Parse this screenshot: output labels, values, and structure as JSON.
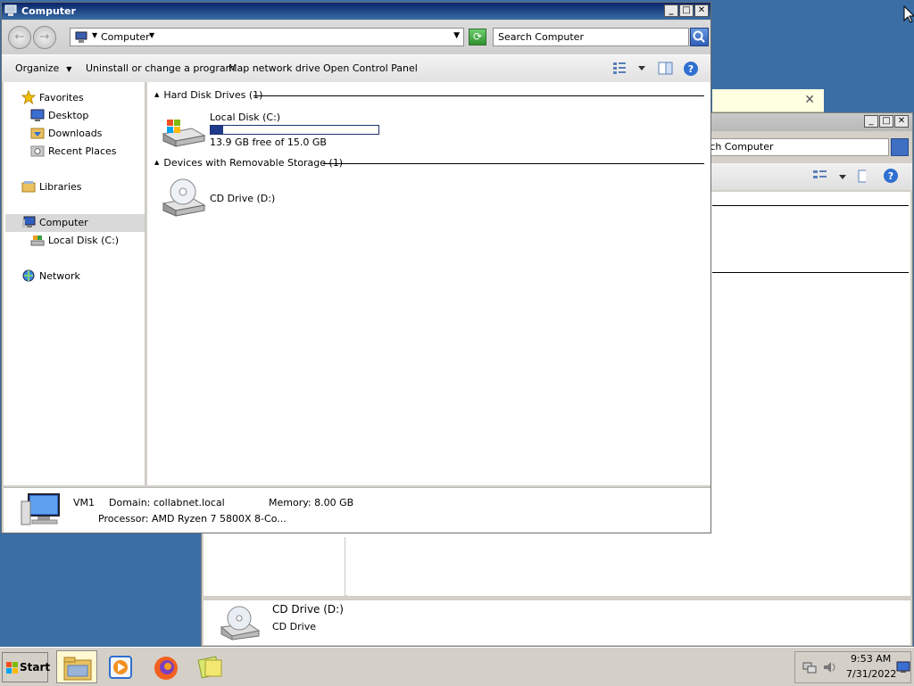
{
  "main_window": {
    "title": "Computer",
    "address": {
      "crumb": "Computer"
    },
    "search": {
      "placeholder": "Search Computer"
    },
    "toolbar": {
      "organize": "Organize",
      "uninstall": "Uninstall or change a program",
      "map_drive": "Map network drive",
      "control_panel": "Open Control Panel"
    },
    "nav": {
      "favorites": "Favorites",
      "desktop": "Desktop",
      "downloads": "Downloads",
      "recent_places": "Recent Places",
      "libraries": "Libraries",
      "computer": "Computer",
      "local_disk": "Local Disk (C:)",
      "network": "Network"
    },
    "content": {
      "hdd_group": "Hard Disk Drives (1)",
      "local_disk_name": "Local Disk (C:)",
      "local_disk_free": "13.9 GB free of 15.0 GB",
      "local_disk_used_fraction": 0.073,
      "removable_group": "Devices with Removable Storage (1)",
      "cd_drive_name": "CD Drive (D:)"
    },
    "details": {
      "computer_name": "VM1",
      "domain": "Domain: collabnet.local",
      "memory": "Memory: 8.00 GB",
      "processor": "Processor: AMD Ryzen 7 5800X 8-Co..."
    }
  },
  "background_window": {
    "search_partial": "rch Computer",
    "cd_drive_title": "CD Drive (D:)",
    "cd_drive_type": "CD Drive"
  },
  "taskbar": {
    "start": "Start",
    "time": "9:53 AM",
    "date": "7/31/2022"
  },
  "colors": {
    "desktop": "#3a6ea5",
    "titlebar_start": "#0a246a",
    "titlebar_end": "#3a6ea5",
    "progress_fill": "#1f3a8a"
  }
}
